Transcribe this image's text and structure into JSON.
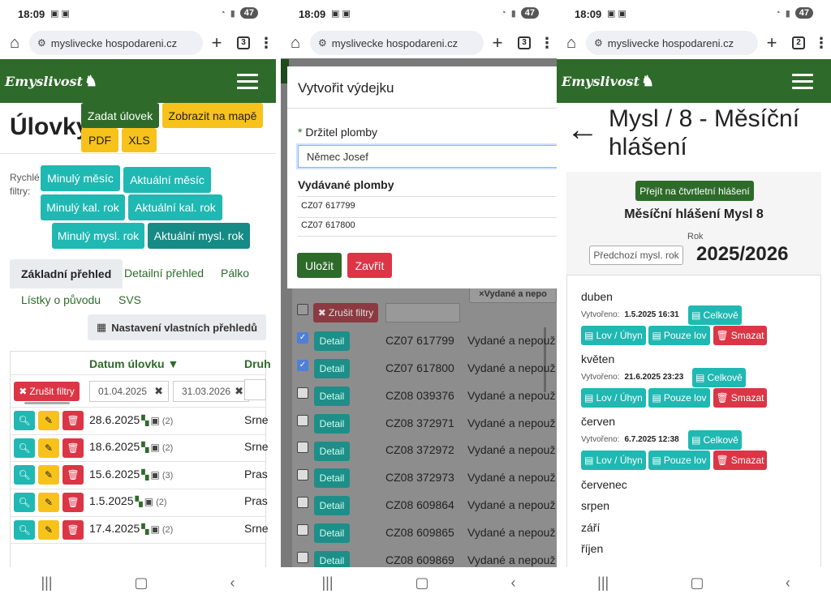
{
  "status": {
    "time": "18:09",
    "battery": "47"
  },
  "screens": [
    {
      "url": "myslivecke hospodareni.cz",
      "tabs": "3"
    },
    {
      "url": "myslivecke hospodareni.cz",
      "tabs": "3"
    },
    {
      "url": "myslivecke hospodareni.cz",
      "tabs": "2"
    }
  ],
  "brand": "Emyslivost",
  "s1": {
    "title": "Úlovky",
    "btn_zadat": "Zadat úlovek",
    "btn_mapa": "Zobrazit na mapě",
    "btn_pdf": "PDF",
    "btn_xls": "XLS",
    "quick_label_1": "Rychlé",
    "quick_label_2": "filtry:",
    "f_minuly_mesic": "Minulý měsíc",
    "f_aktualni_mesic": "Aktuální měsíc",
    "f_minuly_kal": "Minulý kal. rok",
    "f_aktualni_kal": "Aktuální kal. rok",
    "f_minuly_mysl": "Minulý mysl. rok",
    "f_aktualni_mysl": "Aktuální mysl. rok",
    "tab_zakladni": "Základní přehled",
    "tab_detailni": "Detailní přehled",
    "tab_palko": "Pálko",
    "tab_listky": "Lístky o původu",
    "tab_svs": "SVS",
    "btn_nastaveni": "Nastavení vlastních přehledů",
    "col_datum": "Datum úlovku ▼",
    "col_druh": "Druh",
    "btn_zrusit": "Zrušit filtry",
    "date_from": "01.04.2025",
    "date_to": "31.03.2026",
    "rows": [
      {
        "date": "28.6.2025",
        "count": "(2)",
        "kind": "Srne"
      },
      {
        "date": "18.6.2025",
        "count": "(2)",
        "kind": "Srne"
      },
      {
        "date": "15.6.2025",
        "count": "(3)",
        "kind": "Pras"
      },
      {
        "date": "1.5.2025",
        "count": "(2)",
        "kind": "Pras"
      },
      {
        "date": "17.4.2025",
        "count": "(2)",
        "kind": "Srne"
      }
    ]
  },
  "s2": {
    "modal_title": "Vytvořit výdejku",
    "req_mark": "*",
    "label_drzitel": "Držitel plomby",
    "drzitel_value": "Němec Josef",
    "label_plomby": "Vydávané plomby",
    "plomby": [
      "CZ07 617799",
      "CZ07 617800"
    ],
    "btn_ulozit": "Uložit",
    "btn_zavrit": "Zavřít",
    "filter_chip": "Vydané a nepo",
    "btn_zrusit": "Zrušit filtry",
    "detail": "Detail",
    "rows": [
      {
        "code": "CZ07 617799",
        "state": "Vydané a nepouž",
        "checked": true
      },
      {
        "code": "CZ07 617800",
        "state": "Vydané a nepouž",
        "checked": true
      },
      {
        "code": "CZ08 039376",
        "state": "Vydané a nepouž",
        "checked": false
      },
      {
        "code": "CZ08 372971",
        "state": "Vydané a nepouž",
        "checked": false
      },
      {
        "code": "CZ08 372972",
        "state": "Vydané a nepouž",
        "checked": false
      },
      {
        "code": "CZ08 372973",
        "state": "Vydané a nepouž",
        "checked": false
      },
      {
        "code": "CZ08 609864",
        "state": "Vydané a nepouž",
        "checked": false
      },
      {
        "code": "CZ08 609865",
        "state": "Vydané a nepouž",
        "checked": false
      },
      {
        "code": "CZ08 609869",
        "state": "Vydané a nepouž",
        "checked": false
      }
    ]
  },
  "s3": {
    "title": "Mysl / 8 - Měsíční hlášení",
    "btn_ctvrtletni": "Přejít na čtvrtletní hlášení",
    "subtitle": "Měsíční hlášení Mysl 8",
    "rok_label": "Rok",
    "btn_predchozi": "Předchozí mysl. rok",
    "rok_value": "2025/2026",
    "vytvoreno": "Vytvořeno:",
    "btn_celkove": "Celkově",
    "btn_lov": "Lov / Úhyn",
    "btn_pouze": "Pouze lov",
    "btn_smazat": "Smazat",
    "months": [
      {
        "name": "duben",
        "created": "1.5.2025 16:31"
      },
      {
        "name": "květen",
        "created": "21.6.2025 23:23"
      },
      {
        "name": "červen",
        "created": "6.7.2025 12:38"
      }
    ],
    "other_months": [
      "červenec",
      "srpen",
      "září",
      "říjen"
    ]
  }
}
